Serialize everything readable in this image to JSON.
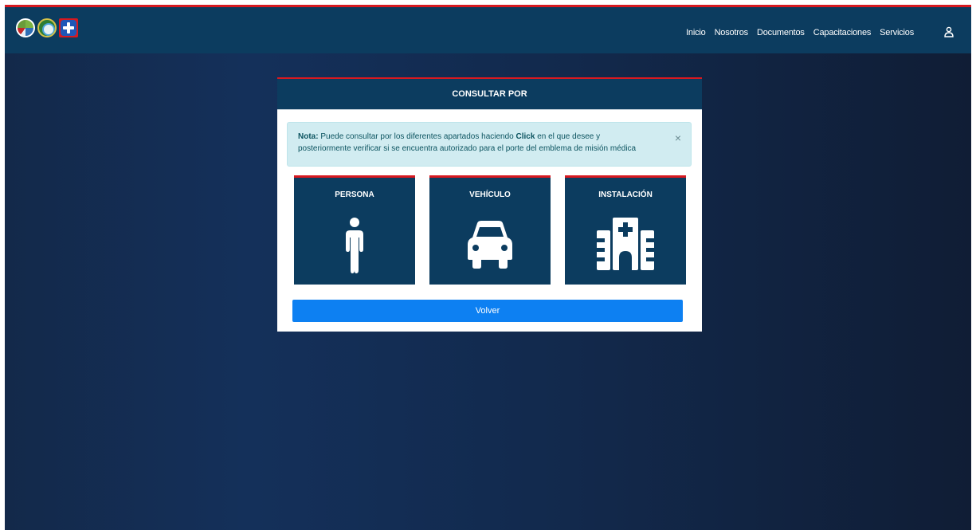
{
  "nav": {
    "items": [
      "Inicio",
      "Nosotros",
      "Documentos",
      "Capacitaciones",
      "Servicios"
    ]
  },
  "card": {
    "title": "CONSULTAR POR",
    "note": {
      "label": "Nota:",
      "text_before": " Puede consultar por los diferentes apartados haciendo ",
      "emphasis": "Click",
      "text_after": " en el que desee y posteriormente verificar si se encuentra autorizado para el porte del emblema de misión médica",
      "close": "×"
    },
    "options": [
      {
        "label": "PERSONA",
        "icon": "person-icon"
      },
      {
        "label": "VEHÍCULO",
        "icon": "car-icon"
      },
      {
        "label": "INSTALACIÓN",
        "icon": "hospital-icon"
      }
    ],
    "back_label": "Volver"
  },
  "colors": {
    "header_bg": "#0c3c5f",
    "accent_red": "#d71920",
    "button_blue": "#0d80f2",
    "note_bg": "#d1ecf1"
  }
}
